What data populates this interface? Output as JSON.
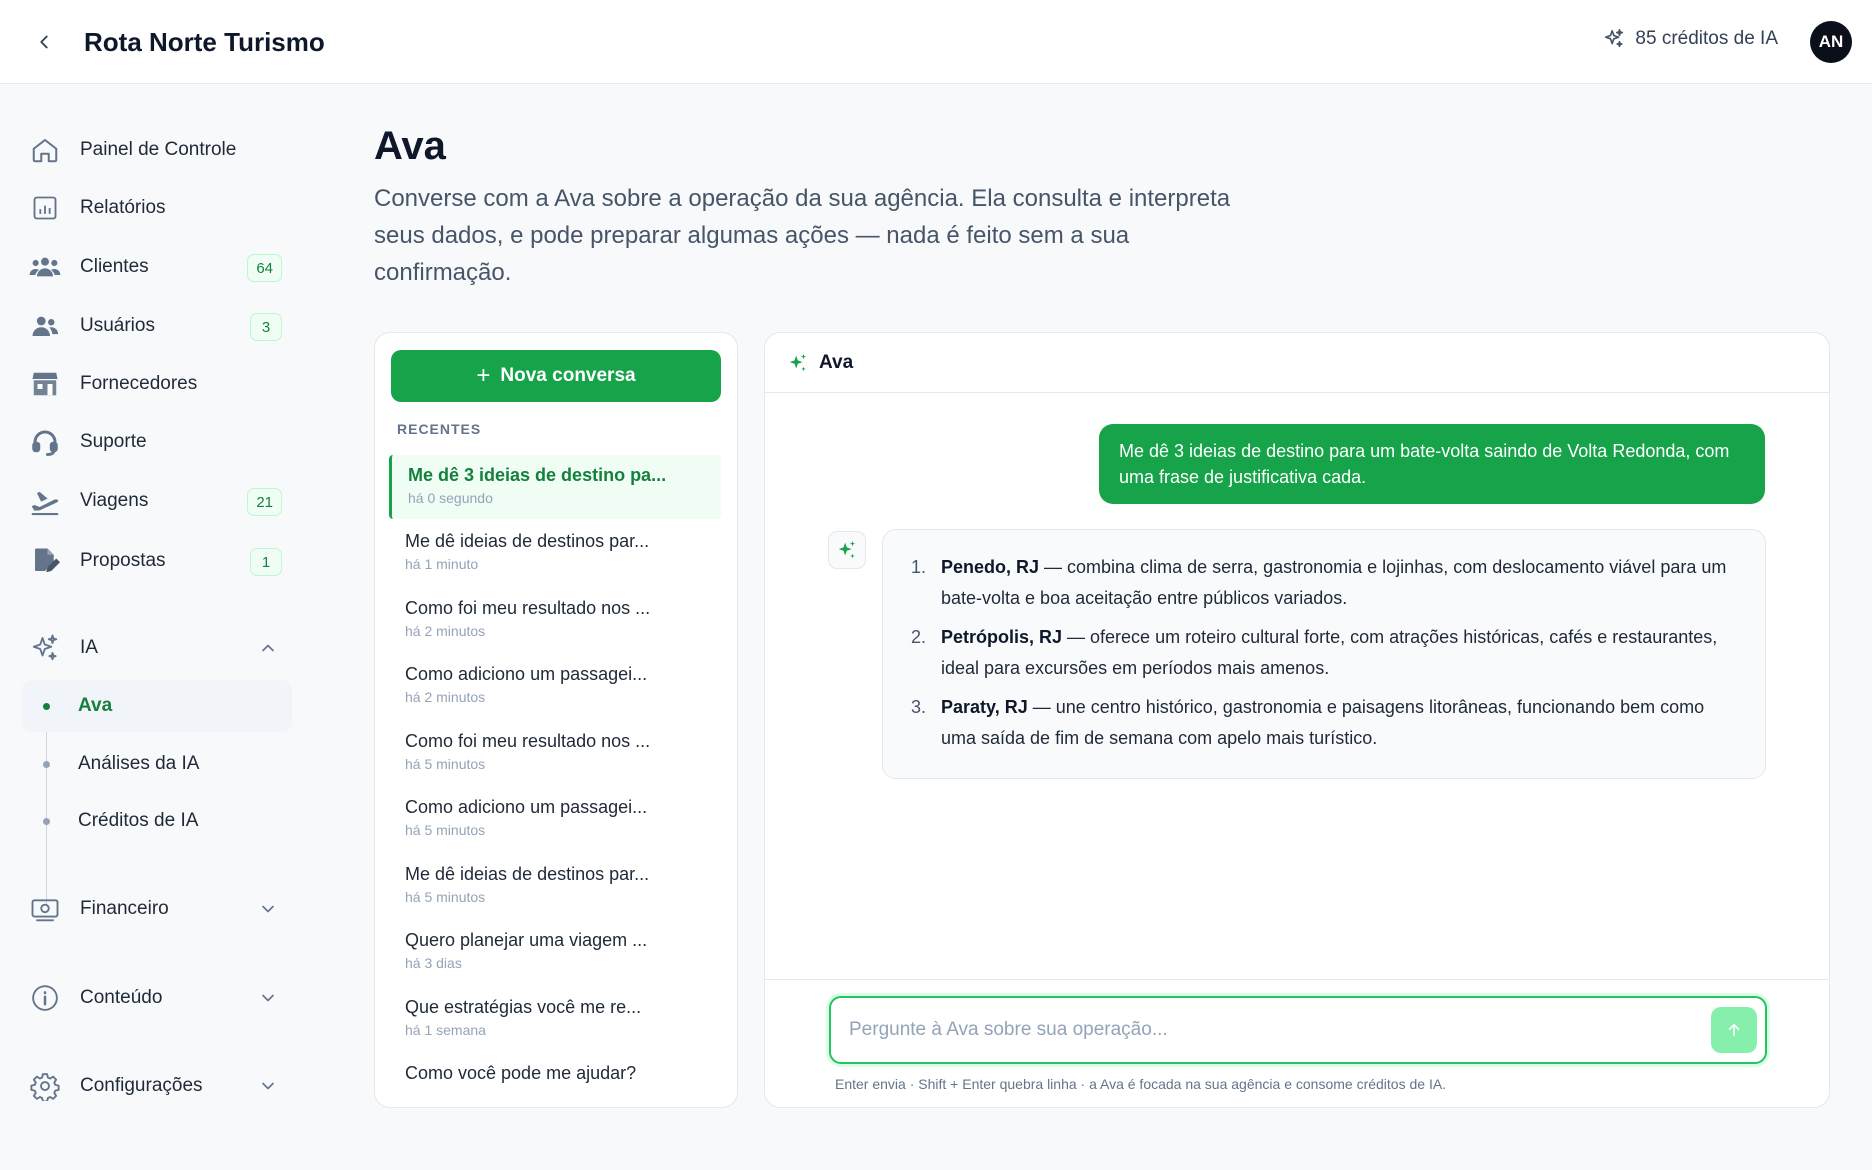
{
  "header": {
    "title": "Rota Norte Turismo",
    "credits_label": "85 créditos de IA",
    "avatar_initials": "AN"
  },
  "sidebar": {
    "items": [
      {
        "label": "Painel de Controle",
        "icon": "home-icon"
      },
      {
        "label": "Relatórios",
        "icon": "report-icon"
      },
      {
        "label": "Clientes",
        "icon": "clients-icon",
        "badge": "64"
      },
      {
        "label": "Usuários",
        "icon": "users-icon",
        "badge": "3"
      },
      {
        "label": "Fornecedores",
        "icon": "store-icon"
      },
      {
        "label": "Suporte",
        "icon": "headset-icon"
      },
      {
        "label": "Viagens",
        "icon": "plane-icon",
        "badge": "21"
      },
      {
        "label": "Propostas",
        "icon": "edit-document-icon",
        "badge": "1"
      }
    ],
    "ia_section": {
      "label": "IA",
      "sub_items": [
        {
          "label": "Ava",
          "active": true
        },
        {
          "label": "Análises da IA"
        },
        {
          "label": "Créditos de IA"
        }
      ]
    },
    "bottom_items": [
      {
        "label": "Financeiro",
        "icon": "money-icon"
      },
      {
        "label": "Conteúdo",
        "icon": "info-icon"
      },
      {
        "label": "Configurações",
        "icon": "gear-icon"
      }
    ]
  },
  "main": {
    "title": "Ava",
    "description": "Converse com a Ava sobre a operação da sua agência. Ela consulta e interpreta seus dados, e pode preparar algumas ações — nada é feito sem a sua confirmação."
  },
  "conversations": {
    "new_button_label": "Nova conversa",
    "section_label": "RECENTES",
    "items": [
      {
        "title": "Me dê 3 ideias de destino pa...",
        "time": "há 0 segundo",
        "active": true
      },
      {
        "title": "Me dê ideias de destinos par...",
        "time": "há 1 minuto"
      },
      {
        "title": "Como foi meu resultado nos ...",
        "time": "há 2 minutos"
      },
      {
        "title": "Como adiciono um passagei...",
        "time": "há 2 minutos"
      },
      {
        "title": "Como foi meu resultado nos ...",
        "time": "há 5 minutos"
      },
      {
        "title": "Como adiciono um passagei...",
        "time": "há 5 minutos"
      },
      {
        "title": "Me dê ideias de destinos par...",
        "time": "há 5 minutos"
      },
      {
        "title": "Quero planejar uma viagem ...",
        "time": "há 3 dias"
      },
      {
        "title": "Que estratégias você me re...",
        "time": "há 1 semana"
      },
      {
        "title": "Como você pode me ajudar?",
        "time": ""
      }
    ]
  },
  "chat": {
    "header_name": "Ava",
    "user_message": "Me dê 3 ideias de destino para um bate-volta saindo de Volta Redonda, com uma frase de justificativa cada.",
    "ava_response": [
      {
        "num": "1.",
        "place": "Penedo, RJ",
        "text": " — combina clima de serra, gastronomia e lojinhas, com deslocamento viável para um bate-volta e boa aceitação entre públicos variados."
      },
      {
        "num": "2.",
        "place": "Petrópolis, RJ",
        "text": " — oferece um roteiro cultural forte, com atrações históricas, cafés e restaurantes, ideal para excursões em períodos mais amenos."
      },
      {
        "num": "3.",
        "place": "Paraty, RJ",
        "text": " — une centro histórico, gastronomia e paisagens litorâneas, funcionando bem como uma saída de fim de semana com apelo mais turístico."
      }
    ],
    "input_placeholder": "Pergunte à Ava sobre sua operação...",
    "input_value": "",
    "hint": "Enter envia · Shift + Enter quebra linha · a Ava é focada na sua agência e consome créditos de IA."
  },
  "colors": {
    "accent": "#16a34a",
    "accent_dark": "#15803d",
    "send_button": "#86efac"
  }
}
